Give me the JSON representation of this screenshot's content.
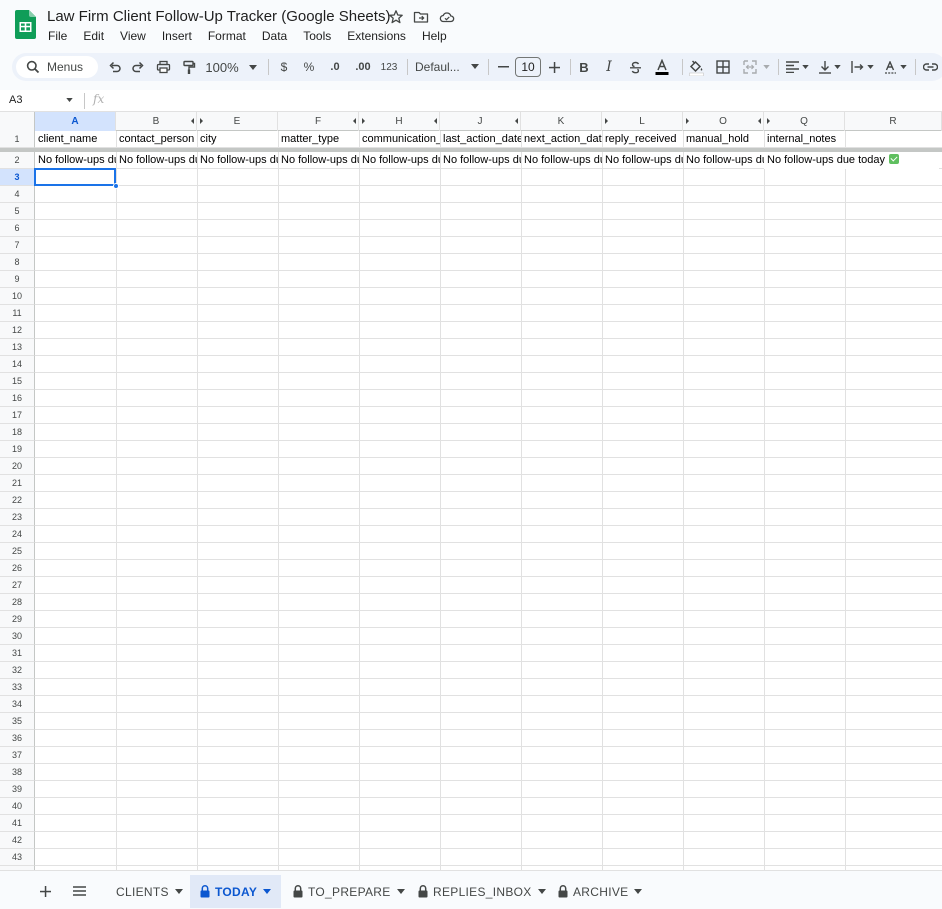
{
  "doc": {
    "title": "Law Firm Client Follow-Up Tracker (Google Sheets)"
  },
  "menu": [
    "File",
    "Edit",
    "View",
    "Insert",
    "Format",
    "Data",
    "Tools",
    "Extensions",
    "Help"
  ],
  "toolbar": {
    "search_label": "Menus",
    "zoom": "100%",
    "currency": "$",
    "percent": "%",
    "dec_decrease": ".0",
    "dec_increase": ".00",
    "number_format": "123",
    "font": "Defaul...",
    "font_size": "10",
    "bold": "B",
    "italic": "I"
  },
  "formula_bar": {
    "cell_ref": "A3",
    "fx": "fx",
    "value": ""
  },
  "columns": [
    {
      "letter": "A",
      "header": "client_name",
      "selected": true
    },
    {
      "letter": "B",
      "header": "contact_person"
    },
    {
      "letter": "E",
      "header": "city"
    },
    {
      "letter": "F",
      "header": "matter_type"
    },
    {
      "letter": "H",
      "header": "communication_"
    },
    {
      "letter": "J",
      "header": "last_action_date"
    },
    {
      "letter": "K",
      "header": "next_action_date"
    },
    {
      "letter": "L",
      "header": "reply_received"
    },
    {
      "letter": "O",
      "header": "manual_hold"
    },
    {
      "letter": "Q",
      "header": "internal_notes"
    },
    {
      "letter": "R",
      "header": ""
    }
  ],
  "row2_value": "No follow-ups due today",
  "row2_emoji": "check-mark-button",
  "row_count": 43,
  "active_cell": "A3",
  "sheet_tabs": [
    {
      "label": "CLIENTS",
      "locked": false,
      "active": false
    },
    {
      "label": "TODAY",
      "locked": true,
      "active": true
    },
    {
      "label": "TO_PREPARE",
      "locked": true,
      "active": false
    },
    {
      "label": "REPLIES_INBOX",
      "locked": true,
      "active": false
    },
    {
      "label": "ARCHIVE",
      "locked": true,
      "active": false
    }
  ],
  "colors": {
    "accent": "#0b57d0",
    "selection": "#1a73e8",
    "header_selected_bg": "#d3e3fd",
    "sheets_green": "#0f9d58"
  }
}
